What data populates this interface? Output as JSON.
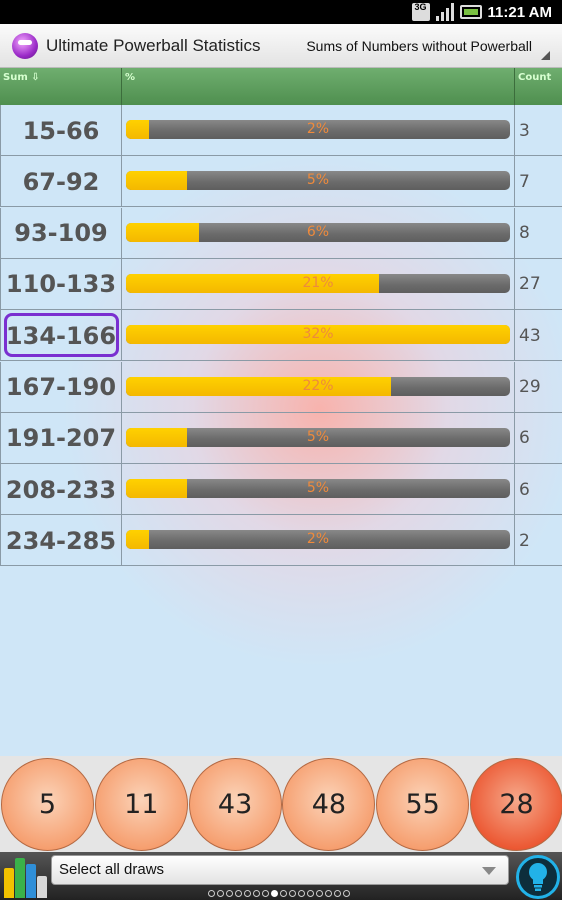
{
  "status_bar": {
    "network": "3G",
    "time": "11:21 AM"
  },
  "app": {
    "title": "Ultimate Powerball Statistics",
    "mode": "Sums of Numbers without Powerball"
  },
  "table": {
    "headers": {
      "sum": "Sum ⇩",
      "percent": "%",
      "count": "Count"
    },
    "selected_row": 4,
    "rows": [
      {
        "sum": "15-66",
        "percent": "2%",
        "fill": 6,
        "count": "3"
      },
      {
        "sum": "67-92",
        "percent": "5%",
        "fill": 16,
        "count": "7"
      },
      {
        "sum": "93-109",
        "percent": "6%",
        "fill": 19,
        "count": "8"
      },
      {
        "sum": "110-133",
        "percent": "21%",
        "fill": 66,
        "count": "27"
      },
      {
        "sum": "134-166",
        "percent": "32%",
        "fill": 100,
        "count": "43"
      },
      {
        "sum": "167-190",
        "percent": "22%",
        "fill": 69,
        "count": "29"
      },
      {
        "sum": "191-207",
        "percent": "5%",
        "fill": 16,
        "count": "6"
      },
      {
        "sum": "208-233",
        "percent": "5%",
        "fill": 16,
        "count": "6"
      },
      {
        "sum": "234-285",
        "percent": "2%",
        "fill": 6,
        "count": "2"
      }
    ]
  },
  "balls": [
    "5",
    "11",
    "43",
    "48",
    "55",
    "28"
  ],
  "powerball_index": 5,
  "bottom": {
    "draws_select": "Select all draws",
    "page_count": 16,
    "active_page": 7
  },
  "colors": {
    "bar_fill": "#ffd100",
    "bar_track": "#6c6c6c",
    "bar_text": "#ee8a3c",
    "header_green": "#5a9a5a",
    "highlight": "#7a2fd0",
    "ball": "#f6a071",
    "powerball": "#ec5a35",
    "tip_accent": "#22b2e8"
  },
  "icons": [
    "3g-icon",
    "signal-icon",
    "battery-icon",
    "app-icon",
    "dropdown-arrow-icon",
    "bar-chart-icon",
    "lightbulb-icon"
  ]
}
